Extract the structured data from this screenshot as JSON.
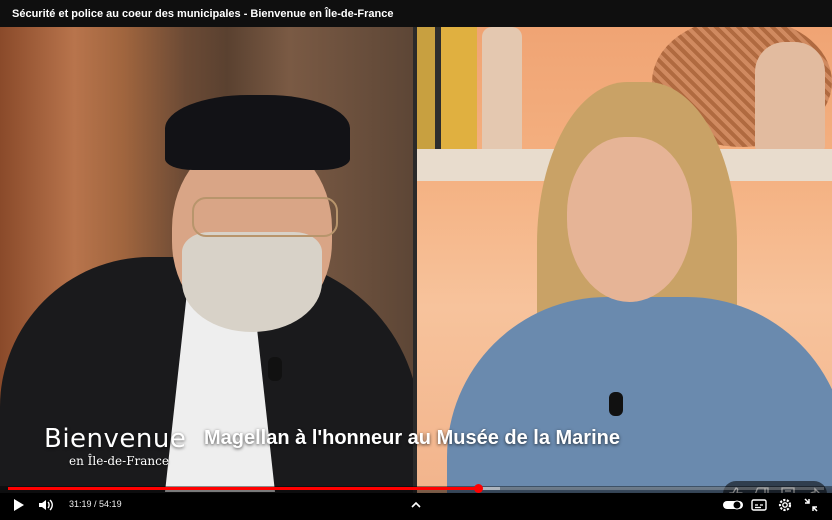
{
  "window": {
    "title": "Sécurité et police au coeur des municipales - Bienvenue en Île-de-France"
  },
  "video": {
    "logo_main": "Bienvenue",
    "logo_sub": "en Île-de-France",
    "headline": "Magellan à l'honneur au Musée de la Marine"
  },
  "player": {
    "current_time": "31:19",
    "separator": " / ",
    "duration": "54:19",
    "progress_fraction": 0.576,
    "buffered_fraction": 0.603,
    "accent_color": "#ff0000"
  },
  "icons": {
    "play": "play-icon",
    "volume": "volume-icon",
    "chevron": "chevron-up-icon",
    "autoplay": "autoplay-toggle-icon",
    "subtitles": "subtitles-icon",
    "settings": "gear-icon",
    "exit_fullscreen": "exit-fullscreen-icon",
    "like": "thumbs-up-icon",
    "dislike": "thumbs-down-icon",
    "comment": "comment-icon",
    "share": "share-icon"
  }
}
